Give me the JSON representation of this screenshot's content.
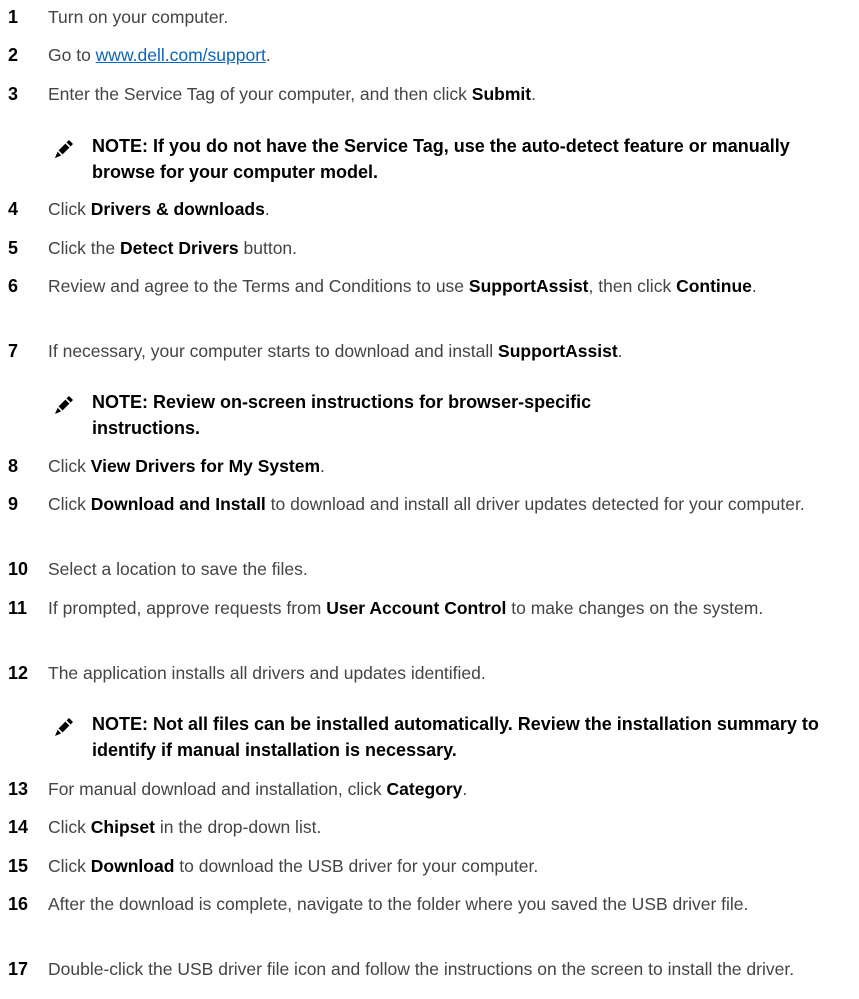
{
  "steps": [
    {
      "num": "1",
      "parts": [
        {
          "t": "Turn on your computer."
        }
      ]
    },
    {
      "num": "2",
      "parts": [
        {
          "t": "Go to "
        },
        {
          "t": "www.dell.com/support",
          "link": true
        },
        {
          "t": "."
        }
      ]
    },
    {
      "num": "3",
      "parts": [
        {
          "t": "Enter the Service Tag of your computer, and then click "
        },
        {
          "t": "Submit",
          "b": true
        },
        {
          "t": "."
        }
      ]
    },
    {
      "num": "4",
      "parts": [
        {
          "t": "Click "
        },
        {
          "t": "Drivers & downloads",
          "b": true
        },
        {
          "t": "."
        }
      ]
    },
    {
      "num": "5",
      "parts": [
        {
          "t": "Click the "
        },
        {
          "t": "Detect Drivers",
          "b": true
        },
        {
          "t": " button."
        }
      ]
    },
    {
      "num": "6",
      "parts": [
        {
          "t": "Review and agree to the Terms and Conditions to use "
        },
        {
          "t": "SupportAssist",
          "b": true
        },
        {
          "t": ", then click "
        },
        {
          "t": "Continue",
          "b": true
        },
        {
          "t": "."
        }
      ]
    },
    {
      "num": "7",
      "parts": [
        {
          "t": "If necessary, your computer starts to download and install "
        },
        {
          "t": "SupportAssist",
          "b": true
        },
        {
          "t": "."
        }
      ]
    },
    {
      "num": "8",
      "parts": [
        {
          "t": "Click "
        },
        {
          "t": "View Drivers for My System",
          "b": true
        },
        {
          "t": "."
        }
      ]
    },
    {
      "num": "9",
      "parts": [
        {
          "t": "Click "
        },
        {
          "t": "Download and Install",
          "b": true
        },
        {
          "t": " to download and install all driver updates detected for your computer."
        }
      ]
    },
    {
      "num": "10",
      "parts": [
        {
          "t": "Select a location to save the files."
        }
      ]
    },
    {
      "num": "11",
      "parts": [
        {
          "t": "If prompted, approve requests from "
        },
        {
          "t": "User Account Control",
          "b": true
        },
        {
          "t": " to make changes on the system."
        }
      ]
    },
    {
      "num": "12",
      "parts": [
        {
          "t": "The application installs all drivers and updates identified."
        }
      ]
    },
    {
      "num": "13",
      "parts": [
        {
          "t": "For manual download and installation, click "
        },
        {
          "t": "Category",
          "b": true
        },
        {
          "t": "."
        }
      ]
    },
    {
      "num": "14",
      "parts": [
        {
          "t": "Click "
        },
        {
          "t": "Chipset",
          "b": true
        },
        {
          "t": " in the drop-down list."
        }
      ]
    },
    {
      "num": "15",
      "parts": [
        {
          "t": "Click "
        },
        {
          "t": "Download",
          "b": true
        },
        {
          "t": " to download the USB driver for your computer."
        }
      ]
    },
    {
      "num": "16",
      "parts": [
        {
          "t": "After the download is complete, navigate to the folder where you saved the USB driver file."
        }
      ]
    },
    {
      "num": "17",
      "parts": [
        {
          "t": "Double-click the USB driver file icon and follow the instructions on the screen to install the driver."
        }
      ]
    }
  ],
  "notes": [
    {
      "text": "NOTE: If you do not have the Service Tag, use the auto-detect feature or manually browse for your computer model.",
      "icon": "pencil-note-icon"
    },
    {
      "text": "NOTE: Review on-screen instructions for browser-specific instructions.",
      "icon": "pencil-note-icon"
    },
    {
      "text": "NOTE: Not all files can be installed automatically. Review the installation summary to identify if manual installation is necessary.",
      "icon": "pencil-note-icon"
    }
  ],
  "colors": {
    "link": "#0a66c2",
    "body_text": "#444444",
    "bold_text": "#000000"
  }
}
